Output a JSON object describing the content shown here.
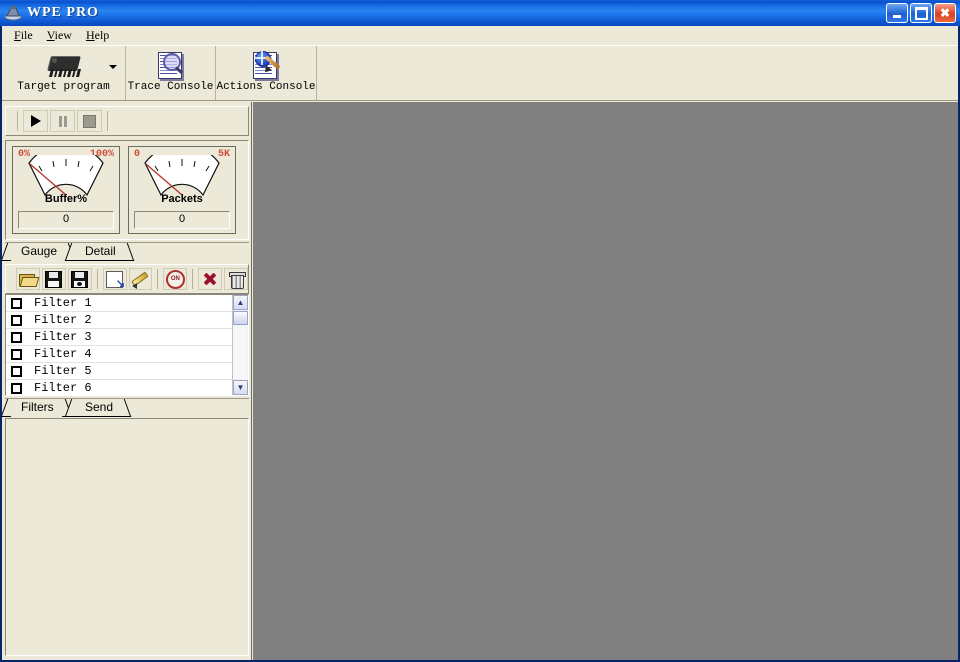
{
  "window": {
    "title": "WPE PRO",
    "icon": "app-icon",
    "buttons": {
      "minimize": "minimize",
      "maximize": "maximize",
      "close": "close"
    }
  },
  "menu": {
    "items": [
      {
        "accel": "F",
        "rest": "ile",
        "label": "File"
      },
      {
        "accel": "V",
        "rest": "iew",
        "label": "View"
      },
      {
        "accel": "H",
        "rest": "elp",
        "label": "Help"
      }
    ]
  },
  "toolbar": {
    "buttons": [
      {
        "label": "Target program",
        "icon": "chip-icon",
        "has_dropdown": true
      },
      {
        "label": "Trace Console",
        "icon": "trace-console-icon",
        "has_dropdown": false
      },
      {
        "label": "Actions Console",
        "icon": "actions-console-icon",
        "has_dropdown": false
      }
    ]
  },
  "capture_toolbar": {
    "buttons": [
      {
        "name": "start",
        "icon": "play-icon",
        "enabled": true
      },
      {
        "name": "pause",
        "icon": "pause-icon",
        "enabled": false
      },
      {
        "name": "stop",
        "icon": "stop-icon",
        "enabled": false
      }
    ]
  },
  "gauges": [
    {
      "name": "Buffer%",
      "min": "0%",
      "max": "100%",
      "value": "0"
    },
    {
      "name": "Packets",
      "min": "0",
      "max": "5K",
      "value": "0"
    }
  ],
  "gauge_tabs": {
    "items": [
      {
        "label": "Gauge",
        "active": true
      },
      {
        "label": "Detail",
        "active": false
      }
    ]
  },
  "filters_toolbar": {
    "buttons": [
      {
        "name": "open-filter",
        "icon": "open-folder-icon"
      },
      {
        "name": "save-filter",
        "icon": "save-icon"
      },
      {
        "name": "save-filter-as",
        "icon": "save-as-icon"
      },
      {
        "name": "import-filter",
        "icon": "import-icon"
      },
      {
        "name": "edit-filter",
        "icon": "pencil-icon"
      },
      {
        "name": "toggle-filter-on",
        "icon": "on-icon",
        "label": "ON"
      },
      {
        "name": "disable-filter",
        "icon": "red-x-icon"
      },
      {
        "name": "delete-filter",
        "icon": "trash-icon"
      }
    ]
  },
  "filters": {
    "items": [
      {
        "label": "Filter 1",
        "checked": false
      },
      {
        "label": "Filter 2",
        "checked": false
      },
      {
        "label": "Filter 3",
        "checked": false
      },
      {
        "label": "Filter 4",
        "checked": false
      },
      {
        "label": "Filter 5",
        "checked": false
      },
      {
        "label": "Filter 6",
        "checked": false
      }
    ],
    "scrollbar": {
      "up": "▲",
      "down": "▼"
    }
  },
  "filters_tabs": {
    "items": [
      {
        "label": "Filters",
        "active": true
      },
      {
        "label": "Send",
        "active": false
      }
    ]
  },
  "colors": {
    "titlebar_blue": "#1560d8",
    "panel_beige": "#ECE9D8",
    "mdi_gray": "#808080",
    "gauge_label_red": "#D14B3A",
    "close_red": "#D8401C"
  }
}
